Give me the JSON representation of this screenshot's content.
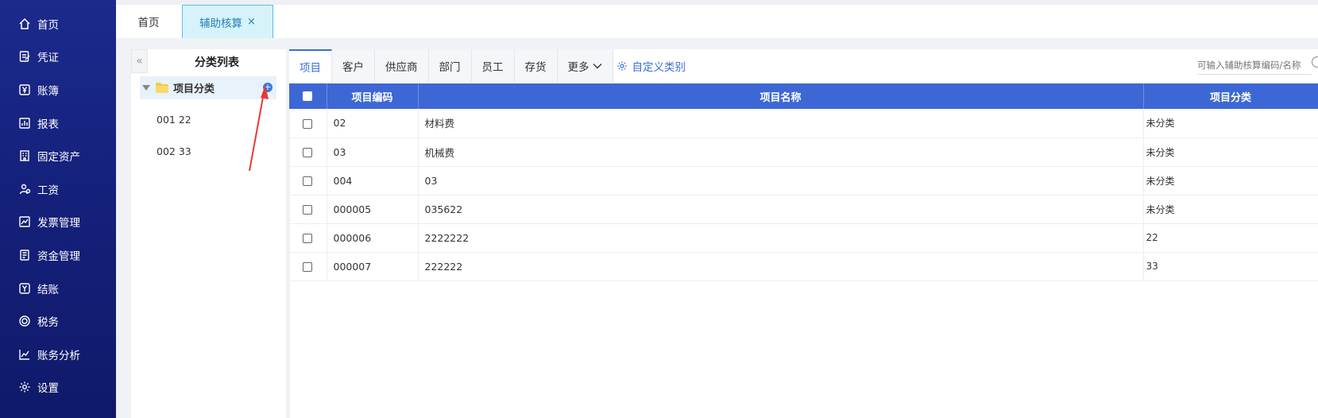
{
  "sidebar": {
    "items": [
      {
        "label": "首页",
        "icon": "home-icon"
      },
      {
        "label": "凭证",
        "icon": "voucher-icon"
      },
      {
        "label": "账簿",
        "icon": "yen-icon"
      },
      {
        "label": "报表",
        "icon": "report-icon"
      },
      {
        "label": "固定资产",
        "icon": "building-icon"
      },
      {
        "label": "工资",
        "icon": "salary-icon"
      },
      {
        "label": "发票管理",
        "icon": "invoice-icon"
      },
      {
        "label": "资金管理",
        "icon": "funds-icon"
      },
      {
        "label": "结账",
        "icon": "closing-icon"
      },
      {
        "label": "税务",
        "icon": "tax-icon"
      },
      {
        "label": "账务分析",
        "icon": "chart-icon"
      },
      {
        "label": "设置",
        "icon": "gear-icon"
      }
    ]
  },
  "top_tabs": {
    "home": "首页",
    "active": "辅助核算",
    "close": "×"
  },
  "category_panel": {
    "collapse_symbol": "«",
    "title": "分类列表",
    "root_label": "项目分类",
    "add_symbol": "+",
    "children": [
      "001 22",
      "002 33"
    ]
  },
  "sub_tabs": {
    "items": [
      "项目",
      "客户",
      "供应商",
      "部门",
      "员工",
      "存货"
    ],
    "more": "更多",
    "custom": "自定义类别"
  },
  "search": {
    "placeholder": "可输入辅助核算编码/名称"
  },
  "table": {
    "headers": {
      "code": "项目编码",
      "name": "项目名称",
      "category": "项目分类"
    },
    "rows": [
      {
        "code": "02",
        "name": "材料费",
        "category": "未分类"
      },
      {
        "code": "03",
        "name": "机械费",
        "category": "未分类"
      },
      {
        "code": "004",
        "name": "03",
        "category": "未分类"
      },
      {
        "code": "000005",
        "name": "035622",
        "category": "未分类"
      },
      {
        "code": "000006",
        "name": "2222222",
        "category": "22"
      },
      {
        "code": "000007",
        "name": "222222",
        "category": "33"
      }
    ]
  },
  "colors": {
    "sidebar_bg": "#1b2a8c",
    "header_blue": "#3d67d4",
    "accent": "#3a6fd6",
    "annotation_arrow": "#e53935"
  }
}
